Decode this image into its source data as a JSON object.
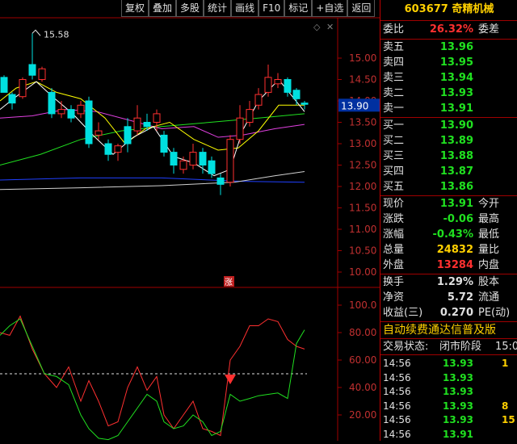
{
  "toolbar": [
    "复权",
    "叠加",
    "多股",
    "统计",
    "画线",
    "F10",
    "标记",
    "+自选",
    "返回"
  ],
  "main_chart": {
    "high_label": "15.58",
    "price_axis": [
      "15.00",
      "14.50",
      "14.00",
      "13.50",
      "13.00",
      "12.50",
      "12.00",
      "11.50",
      "11.00",
      "10.50",
      "10.00"
    ],
    "current_price_tag": "13.90",
    "marker_label": "涨"
  },
  "indicator_chart": {
    "axis": [
      "100.0",
      "80.00",
      "60.00",
      "40.00",
      "20.00"
    ],
    "ref_level": 50
  },
  "stock": {
    "code": "603677",
    "name": "奇精机械"
  },
  "weibi": {
    "label": "委比",
    "value": "26.32%",
    "label2": "委差"
  },
  "asks": [
    {
      "label": "卖五",
      "price": "13.96"
    },
    {
      "label": "卖四",
      "price": "13.95"
    },
    {
      "label": "卖三",
      "price": "13.94"
    },
    {
      "label": "卖二",
      "price": "13.93"
    },
    {
      "label": "卖一",
      "price": "13.91"
    }
  ],
  "bids": [
    {
      "label": "买一",
      "price": "13.90"
    },
    {
      "label": "买二",
      "price": "13.89"
    },
    {
      "label": "买三",
      "price": "13.88"
    },
    {
      "label": "买四",
      "price": "13.87"
    },
    {
      "label": "买五",
      "price": "13.86"
    }
  ],
  "stats": [
    {
      "label": "现价",
      "value": "13.91",
      "label2": "今开",
      "color": "green"
    },
    {
      "label": "涨跌",
      "value": "-0.06",
      "label2": "最高",
      "color": "green"
    },
    {
      "label": "涨幅",
      "value": "-0.43%",
      "label2": "最低",
      "color": "green"
    },
    {
      "label": "总量",
      "value": "24832",
      "label2": "量比",
      "color": "yellow"
    },
    {
      "label": "外盘",
      "value": "13284",
      "label2": "内盘",
      "color": "red"
    }
  ],
  "finance": [
    {
      "label": "换手",
      "value": "1.29%",
      "label2": "股本"
    },
    {
      "label": "净资",
      "value": "5.72",
      "label2": "流通"
    },
    {
      "label": "收益(三)",
      "value": "0.270",
      "label2": "PE(动)"
    }
  ],
  "banner": "自动续费通达信普及版",
  "status": {
    "label": "交易状态:",
    "value": "闭市阶段",
    "time": "15:0"
  },
  "ticks": [
    {
      "time": "14:56",
      "price": "13.93",
      "vol": "1",
      "vcolor": "yellow"
    },
    {
      "time": "14:56",
      "price": "13.93",
      "vol": "",
      "vcolor": "yellow"
    },
    {
      "time": "14:56",
      "price": "13.93",
      "vol": "",
      "vcolor": "yellow"
    },
    {
      "time": "14:56",
      "price": "13.93",
      "vol": "8",
      "vcolor": "yellow"
    },
    {
      "time": "14:56",
      "price": "13.93",
      "vol": "15",
      "vcolor": "yellow"
    },
    {
      "time": "14:56",
      "price": "13.91",
      "vol": "",
      "vcolor": "yellow"
    }
  ],
  "colors": {
    "up": "#ff3030",
    "down": "#00e0e0",
    "ma5": "#ffffff",
    "ma10": "#ffff00",
    "ma20": "#e040e0",
    "ma30": "#20e020",
    "ma60": "#d0d0d0",
    "ma120": "#2040ff"
  }
}
